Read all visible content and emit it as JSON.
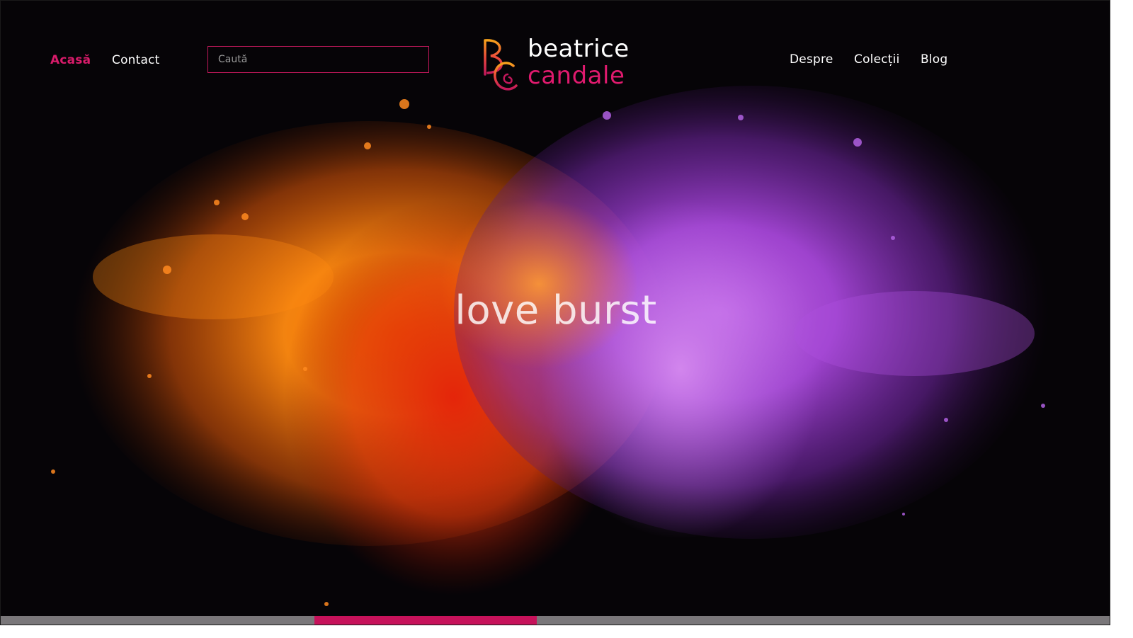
{
  "nav": {
    "left": [
      {
        "label": "Acasă",
        "active": true
      },
      {
        "label": "Contact",
        "active": false
      }
    ],
    "right": [
      {
        "label": "Despre"
      },
      {
        "label": "Colecții"
      },
      {
        "label": "Blog"
      }
    ]
  },
  "search": {
    "placeholder": "Caută",
    "value": ""
  },
  "logo": {
    "monogram": "BC",
    "line1": "beatrice",
    "line2": "candale"
  },
  "hero": {
    "title": "love burst"
  },
  "slider": {
    "active_index": 1,
    "position_fraction": 0.28
  },
  "colors": {
    "accent": "#d81b6a",
    "background": "#060407",
    "orange": "#ff7a00",
    "purple": "#a040d8",
    "slider_track": "#7a777a"
  }
}
